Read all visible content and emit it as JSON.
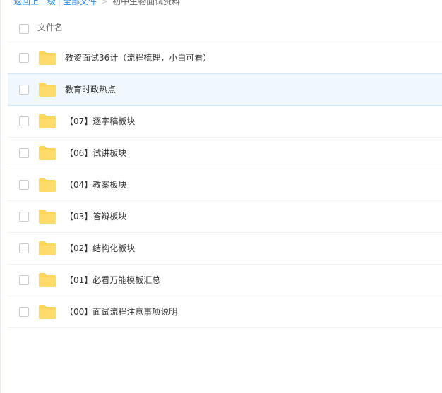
{
  "breadcrumb": {
    "back": "返回上一级",
    "separator": "|",
    "all_files": "全部文件",
    "arrow": ">",
    "current": "初中生物面试资料"
  },
  "header": {
    "name_column": "文件名"
  },
  "files": [
    {
      "name": "教资面试36计（流程梳理，小白可看）",
      "icon": "folder-icon",
      "selected": false
    },
    {
      "name": "教育时政热点",
      "icon": "folder-icon",
      "selected": true
    },
    {
      "name": "【07】逐字稿板块",
      "icon": "folder-icon",
      "selected": false
    },
    {
      "name": "【06】试讲板块",
      "icon": "folder-icon",
      "selected": false
    },
    {
      "name": "【04】教案板块",
      "icon": "folder-icon",
      "selected": false
    },
    {
      "name": "【03】答辩板块",
      "icon": "folder-icon",
      "selected": false
    },
    {
      "name": "【02】结构化板块",
      "icon": "folder-icon",
      "selected": false
    },
    {
      "name": "【01】必看万能模板汇总",
      "icon": "folder-icon",
      "selected": false
    },
    {
      "name": "【00】面试流程注意事项说明",
      "icon": "folder-icon",
      "selected": false
    }
  ],
  "colors": {
    "link": "#2e8ae6",
    "folder": "#ffd659",
    "selected_row_bg": "#f1f8fd",
    "selected_row_border": "#cfe7f8"
  }
}
